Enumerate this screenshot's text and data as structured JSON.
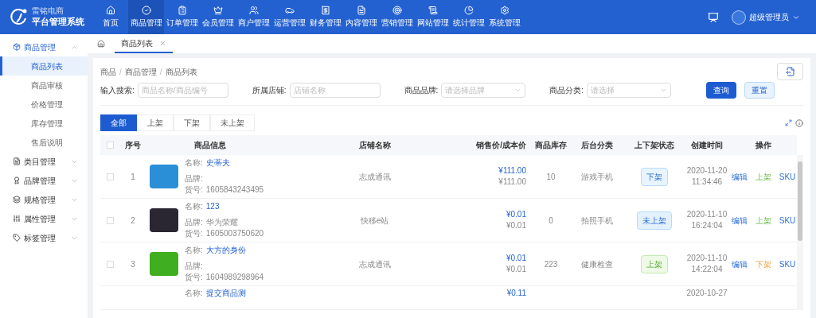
{
  "brand": {
    "subtitle": "雷铭电商",
    "title": "平台管理系统"
  },
  "nav": [
    {
      "label": "首页",
      "selected": false
    },
    {
      "label": "商品管理",
      "selected": true
    },
    {
      "label": "订单管理",
      "selected": false
    },
    {
      "label": "会员管理",
      "selected": false
    },
    {
      "label": "商户管理",
      "selected": false
    },
    {
      "label": "运营管理",
      "selected": false
    },
    {
      "label": "财务管理",
      "selected": false
    },
    {
      "label": "内容管理",
      "selected": false
    },
    {
      "label": "营销管理",
      "selected": false
    },
    {
      "label": "网站管理",
      "selected": false
    },
    {
      "label": "统计管理",
      "selected": false
    },
    {
      "label": "系统管理",
      "selected": false
    }
  ],
  "user": {
    "name": "超级管理员"
  },
  "sidebar": [
    {
      "label": "商品管理",
      "expanded": true,
      "children": [
        {
          "label": "商品列表",
          "selected": true
        },
        {
          "label": "商品审核",
          "selected": false
        },
        {
          "label": "价格管理",
          "selected": false
        },
        {
          "label": "库存管理",
          "selected": false
        },
        {
          "label": "售后说明",
          "selected": false
        }
      ]
    },
    {
      "label": "类目管理",
      "expanded": false
    },
    {
      "label": "品牌管理",
      "expanded": false
    },
    {
      "label": "规格管理",
      "expanded": false
    },
    {
      "label": "属性管理",
      "expanded": false
    },
    {
      "label": "标签管理",
      "expanded": false
    }
  ],
  "page_tabs": [
    {
      "label": "商品列表",
      "selected": true
    }
  ],
  "breadcrumb": {
    "separator": "/",
    "items": [
      "商品",
      "商品管理",
      "商品列表"
    ]
  },
  "filters": [
    {
      "label": "输入搜索:",
      "placeholder": "商品名称/商品编号",
      "kind": "input"
    },
    {
      "label": "所属店铺:",
      "placeholder": "店铺名称",
      "kind": "input"
    },
    {
      "label": "商品品牌:",
      "placeholder": "请选择品牌",
      "kind": "select"
    },
    {
      "label": "商品分类:",
      "placeholder": "请选择",
      "kind": "select"
    }
  ],
  "buttons": {
    "query": "查询",
    "reset": "重置"
  },
  "status_tabs": [
    {
      "label": "全部",
      "selected": true
    },
    {
      "label": "上架",
      "selected": false
    },
    {
      "label": "下架",
      "selected": false
    },
    {
      "label": "未上架",
      "selected": false
    }
  ],
  "table": {
    "all_checked": false,
    "columns": [
      "序号",
      "商品信息",
      "店铺名称",
      "销售价/成本价",
      "商品库存",
      "后台分类",
      "上下架状态",
      "创建时间",
      "操作"
    ],
    "rows": [
      {
        "checked": false,
        "index": "1",
        "name_label": "名称:",
        "name": "史蒂夫",
        "brand_label": "品牌:",
        "code_label": "货号:",
        "code": "1605843243495",
        "shop": "志成通讯",
        "price": "¥111.00",
        "cost": "¥111.00",
        "stock": "10",
        "category": "游戏手机",
        "status": {
          "label": "下架",
          "kind": "off"
        },
        "date": "2020-11-20",
        "time": "11:34:46",
        "actions": [
          {
            "label": "编辑",
            "kind": "edit"
          },
          {
            "label": "上架",
            "kind": "up"
          },
          {
            "label": "SKU",
            "kind": "edit"
          }
        ]
      },
      {
        "checked": false,
        "index": "2",
        "name_label": "名称:",
        "name": "123",
        "brand_label": "品牌:",
        "brand": "华为荣耀",
        "code_label": "货号:",
        "code": "1605003750620",
        "shop": "快移e站",
        "price": "¥0.01",
        "cost": "¥0.01",
        "stock": "0",
        "category": "拍照手机",
        "status": {
          "label": "未上架",
          "kind": "unlisted"
        },
        "date": "2020-11-10",
        "time": "16:24:04",
        "actions": [
          {
            "label": "编辑",
            "kind": "edit"
          },
          {
            "label": "上架",
            "kind": "up"
          },
          {
            "label": "SKU",
            "kind": "edit"
          }
        ]
      },
      {
        "checked": false,
        "index": "3",
        "name_label": "名称:",
        "name": "大方的身份",
        "brand_label": "品牌:",
        "code_label": "货号:",
        "code": "1604989298964",
        "shop": "志成通讯",
        "price": "¥0.01",
        "cost": "¥0.01",
        "stock": "223",
        "category": "健康检查",
        "status": {
          "label": "上架",
          "kind": "on"
        },
        "date": "2020-11-10",
        "time": "14:22:04",
        "actions": [
          {
            "label": "编辑",
            "kind": "edit"
          },
          {
            "label": "下架",
            "kind": "down"
          },
          {
            "label": "SKU",
            "kind": "edit"
          }
        ]
      },
      {
        "name_label": "名称:",
        "name": "提交商品测",
        "price": "¥0.11",
        "date": "2020-10-27"
      }
    ]
  }
}
